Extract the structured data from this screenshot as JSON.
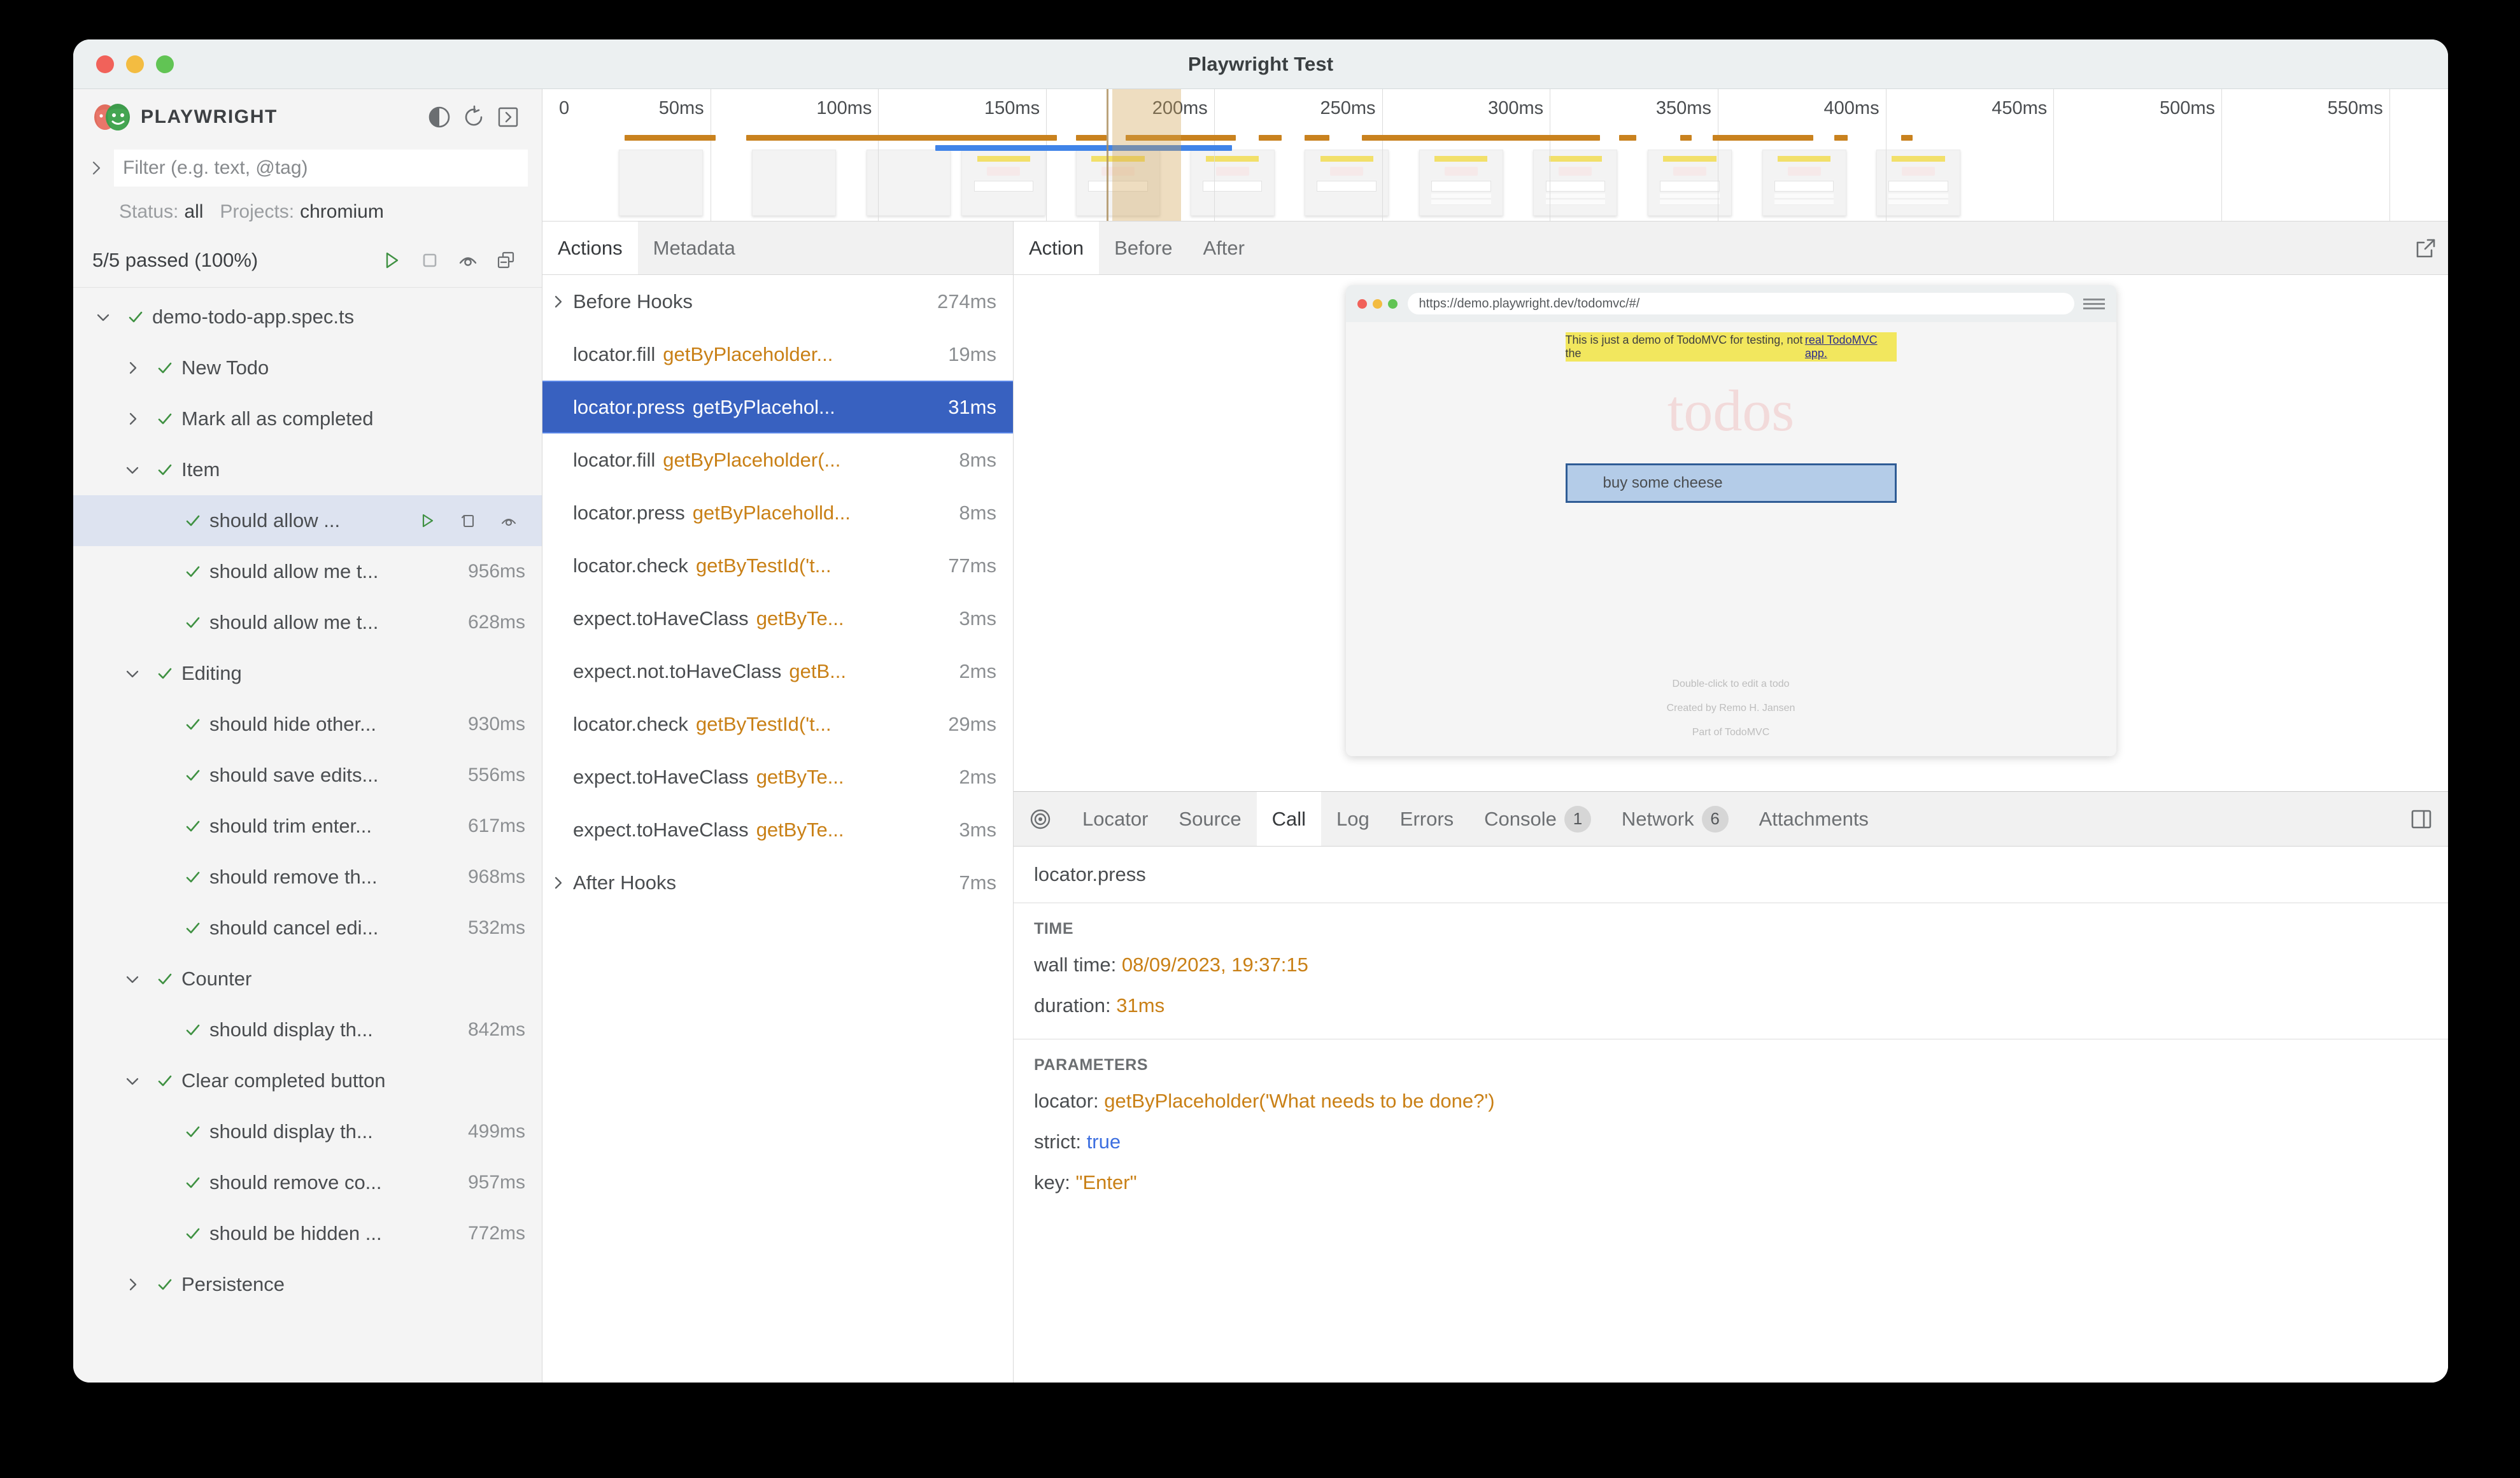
{
  "window": {
    "title": "Playwright Test"
  },
  "sidebar": {
    "brand": "PLAYWRIGHT",
    "header_icons": [
      {
        "name": "theme-toggle-icon",
        "label": "toggle-theme"
      },
      {
        "name": "reload-icon",
        "label": "reload"
      },
      {
        "name": "toggle-sidebar-icon",
        "label": "toggle-sidebar"
      }
    ],
    "filter": {
      "placeholder": "Filter (e.g. text, @tag)",
      "value": ""
    },
    "status": {
      "status_label": "Status:",
      "status_value": "all",
      "projects_label": "Projects:",
      "projects_value": "chromium"
    },
    "summary": {
      "text": "5/5 passed (100%)"
    },
    "toolbar": [
      {
        "name": "run-button",
        "label": "run"
      },
      {
        "name": "stop-button",
        "label": "stop"
      },
      {
        "name": "watch-button",
        "label": "watch"
      },
      {
        "name": "collapse-all-button",
        "label": "collapse-all"
      }
    ],
    "tree": [
      {
        "depth": 0,
        "caret": "down",
        "status": "passed",
        "label": "demo-todo-app.spec.ts",
        "duration": ""
      },
      {
        "depth": 1,
        "caret": "right",
        "status": "passed",
        "label": "New Todo",
        "duration": ""
      },
      {
        "depth": 1,
        "caret": "right",
        "status": "passed",
        "label": "Mark all as completed",
        "duration": ""
      },
      {
        "depth": 1,
        "caret": "down",
        "status": "passed",
        "label": "Item",
        "duration": ""
      },
      {
        "depth": 2,
        "caret": "none",
        "status": "passed",
        "label": "should allow ...",
        "duration": "",
        "selected": true,
        "actions": [
          "run-icon",
          "copy-icon",
          "watch-icon"
        ]
      },
      {
        "depth": 2,
        "caret": "none",
        "status": "passed",
        "label": "should allow me t...",
        "duration": "956ms"
      },
      {
        "depth": 2,
        "caret": "none",
        "status": "passed",
        "label": "should allow me t...",
        "duration": "628ms"
      },
      {
        "depth": 1,
        "caret": "down",
        "status": "passed",
        "label": "Editing",
        "duration": ""
      },
      {
        "depth": 2,
        "caret": "none",
        "status": "passed",
        "label": "should hide other...",
        "duration": "930ms"
      },
      {
        "depth": 2,
        "caret": "none",
        "status": "passed",
        "label": "should save edits...",
        "duration": "556ms"
      },
      {
        "depth": 2,
        "caret": "none",
        "status": "passed",
        "label": "should trim enter...",
        "duration": "617ms"
      },
      {
        "depth": 2,
        "caret": "none",
        "status": "passed",
        "label": "should remove th...",
        "duration": "968ms"
      },
      {
        "depth": 2,
        "caret": "none",
        "status": "passed",
        "label": "should cancel edi...",
        "duration": "532ms"
      },
      {
        "depth": 1,
        "caret": "down",
        "status": "passed",
        "label": "Counter",
        "duration": ""
      },
      {
        "depth": 2,
        "caret": "none",
        "status": "passed",
        "label": "should display th...",
        "duration": "842ms"
      },
      {
        "depth": 1,
        "caret": "down",
        "status": "passed",
        "label": "Clear completed button",
        "duration": ""
      },
      {
        "depth": 2,
        "caret": "none",
        "status": "passed",
        "label": "should display th...",
        "duration": "499ms"
      },
      {
        "depth": 2,
        "caret": "none",
        "status": "passed",
        "label": "should remove co...",
        "duration": "957ms"
      },
      {
        "depth": 2,
        "caret": "none",
        "status": "passed",
        "label": "should be hidden ...",
        "duration": "772ms"
      },
      {
        "depth": 1,
        "caret": "right",
        "status": "passed",
        "label": "Persistence",
        "duration": ""
      }
    ]
  },
  "timeline": {
    "start_label": "0",
    "ticks": [
      "50ms",
      "100ms",
      "150ms",
      "200ms",
      "250ms",
      "300ms",
      "350ms",
      "400ms",
      "450ms",
      "500ms",
      "550ms"
    ],
    "action_bars": [
      {
        "left": 4.3,
        "width": 4.8
      },
      {
        "left": 10.7,
        "width": 16.3
      },
      {
        "left": 28.0,
        "width": 1.6
      },
      {
        "left": 30.6,
        "width": 5.8
      },
      {
        "left": 37.6,
        "width": 1.2
      },
      {
        "left": 40.0,
        "width": 1.3
      },
      {
        "left": 43.0,
        "width": 12.5
      },
      {
        "left": 56.5,
        "width": 0.9
      },
      {
        "left": 59.7,
        "width": 0.6
      },
      {
        "left": 61.4,
        "width": 5.3
      },
      {
        "left": 67.8,
        "width": 0.7
      },
      {
        "left": 71.3,
        "width": 0.6
      }
    ],
    "event_bars": [
      {
        "left": 20.6,
        "width": 15.6
      }
    ],
    "selection": {
      "left": 29.9,
      "width": 3.6
    },
    "cursor": 29.6,
    "films": [
      4,
      11,
      17,
      22,
      28,
      34,
      40,
      46,
      52,
      58,
      64,
      70
    ]
  },
  "actions_panel": {
    "tabs": [
      {
        "label": "Actions",
        "active": true
      },
      {
        "label": "Metadata",
        "active": false
      }
    ],
    "items": [
      {
        "caret": "right",
        "title": "Before Hooks",
        "params": "",
        "duration": "274ms"
      },
      {
        "caret": "none",
        "title": "locator.fill",
        "params": "getByPlaceholder...",
        "duration": "19ms"
      },
      {
        "caret": "none",
        "title": "locator.press",
        "params": "getByPlacehol...",
        "duration": "31ms",
        "selected": true
      },
      {
        "caret": "none",
        "title": "locator.fill",
        "params": "getByPlaceholder(...",
        "duration": "8ms"
      },
      {
        "caret": "none",
        "title": "locator.press",
        "params": "getByPlaceholld...",
        "duration": "8ms"
      },
      {
        "caret": "none",
        "title": "locator.check",
        "params": "getByTestId('t...",
        "duration": "77ms"
      },
      {
        "caret": "none",
        "title": "expect.toHaveClass",
        "params": "getByTe...",
        "duration": "3ms"
      },
      {
        "caret": "none",
        "title": "expect.not.toHaveClass",
        "params": "getB...",
        "duration": "2ms"
      },
      {
        "caret": "none",
        "title": "locator.check",
        "params": "getByTestId('t...",
        "duration": "29ms"
      },
      {
        "caret": "none",
        "title": "expect.toHaveClass",
        "params": "getByTe...",
        "duration": "2ms"
      },
      {
        "caret": "none",
        "title": "expect.toHaveClass",
        "params": "getByTe...",
        "duration": "3ms"
      },
      {
        "caret": "right",
        "title": "After Hooks",
        "params": "",
        "duration": "7ms"
      }
    ]
  },
  "snapshot_panel": {
    "tabs": [
      {
        "label": "Action",
        "active": true
      },
      {
        "label": "Before",
        "active": false
      },
      {
        "label": "After",
        "active": false
      }
    ],
    "popout_icon": "open-external-icon",
    "browser": {
      "url": "https://demo.playwright.dev/todomvc/#/",
      "banner_text": "This is just a demo of TodoMVC for testing, not the ",
      "banner_link": "real TodoMVC app.",
      "app_title": "todos",
      "input_value": "buy some cheese",
      "footer": [
        "Double-click to edit a todo",
        "Created by Remo H. Jansen",
        "Part of TodoMVC"
      ]
    }
  },
  "detail_panel": {
    "tabs": [
      {
        "label": "Locator",
        "active": false,
        "badge": ""
      },
      {
        "label": "Source",
        "active": false,
        "badge": ""
      },
      {
        "label": "Call",
        "active": true,
        "badge": ""
      },
      {
        "label": "Log",
        "active": false,
        "badge": ""
      },
      {
        "label": "Errors",
        "active": false,
        "badge": ""
      },
      {
        "label": "Console",
        "active": false,
        "badge": "1"
      },
      {
        "label": "Network",
        "active": false,
        "badge": "6"
      },
      {
        "label": "Attachments",
        "active": false,
        "badge": ""
      }
    ],
    "split_icon": "split-view-icon",
    "target_icon": "target-icon",
    "call": {
      "title": "locator.press",
      "time_heading": "TIME",
      "wall_time_label": "wall time:",
      "wall_time_value": "08/09/2023, 19:37:15",
      "duration_label": "duration:",
      "duration_value": "31ms",
      "params_heading": "PARAMETERS",
      "locator_label": "locator:",
      "locator_value": "getByPlaceholder('What needs to be done?')",
      "strict_label": "strict:",
      "strict_value": "true",
      "key_label": "key:",
      "key_value": "\"Enter\""
    }
  },
  "colors": {
    "accent_blue": "#3861c0",
    "action_orange": "#c9821e",
    "event_blue": "#4084e8",
    "pass_green": "#3f9142",
    "param_orange": "#c98016"
  }
}
